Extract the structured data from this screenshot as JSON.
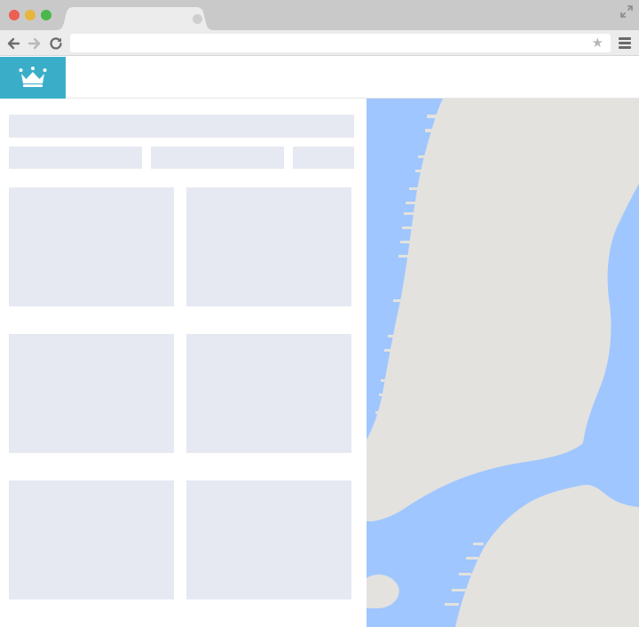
{
  "browser": {
    "address": "",
    "star_glyph": "★",
    "colors": {
      "titlebar": "#c9c9c9",
      "close": "#ec5f53",
      "minimize": "#e8b53b",
      "maximize": "#4bb74a"
    }
  },
  "app": {
    "brand_color": "#3aaec9",
    "logo_icon": "crown-icon"
  },
  "left_panel": {
    "placeholder_color": "#e6e9f1",
    "search_bar": "",
    "filters": [
      "",
      "",
      ""
    ],
    "cards": [
      "",
      "",
      "",
      "",
      "",
      ""
    ]
  },
  "map": {
    "water_color": "#9fc6ff",
    "land_color": "#e3e2de"
  }
}
